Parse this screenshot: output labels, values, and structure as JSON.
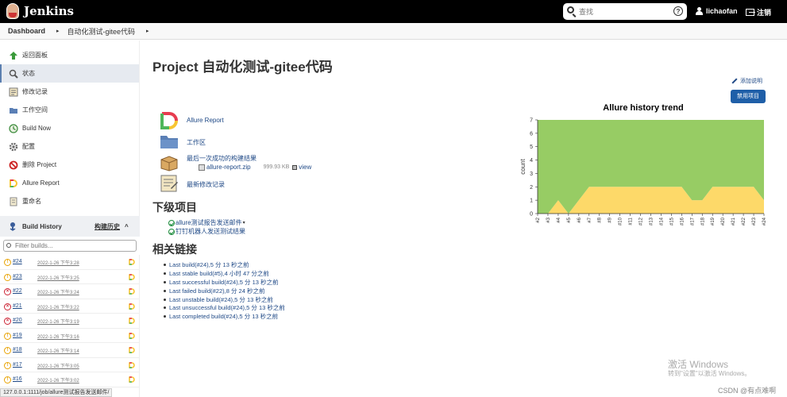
{
  "header": {
    "app_name": "Jenkins",
    "search_placeholder": "查找",
    "help_glyph": "?",
    "username": "lichaofan",
    "logout_label": "注销"
  },
  "breadcrumb": {
    "items": [
      "Dashboard",
      "自动化测试-gitee代码"
    ]
  },
  "sidebar": {
    "tasks": [
      {
        "label": "返回面板",
        "icon": "arrow-up-icon"
      },
      {
        "label": "状态",
        "icon": "magnifier-icon",
        "active": true
      },
      {
        "label": "修改记录",
        "icon": "notepad-icon"
      },
      {
        "label": "工作空间",
        "icon": "folder-icon"
      },
      {
        "label": "Build Now",
        "icon": "clock-icon"
      },
      {
        "label": "配置",
        "icon": "gear-icon"
      },
      {
        "label": "删除 Project",
        "icon": "no-entry-icon"
      },
      {
        "label": "Allure Report",
        "icon": "allure-icon"
      },
      {
        "label": "重命名",
        "icon": "rename-icon"
      }
    ]
  },
  "build_history": {
    "title": "Build History",
    "title_cn": "构建历史",
    "chevron": "^",
    "filter_placeholder": "Filter builds...",
    "builds": [
      {
        "num": "#24",
        "date": "2022-1-26 下午3:28",
        "status": "unstable"
      },
      {
        "num": "#23",
        "date": "2022-1-26 下午3:25",
        "status": "unstable"
      },
      {
        "num": "#22",
        "date": "2022-1-26 下午3:24",
        "status": "failed"
      },
      {
        "num": "#21",
        "date": "2022-1-26 下午3:22",
        "status": "failed"
      },
      {
        "num": "#20",
        "date": "2022-1-26 下午3:19",
        "status": "failed"
      },
      {
        "num": "#19",
        "date": "2022-1-26 下午3:16",
        "status": "unstable"
      },
      {
        "num": "#18",
        "date": "2022-1-26 下午3:14",
        "status": "unstable"
      },
      {
        "num": "#17",
        "date": "2022-1-26 下午3:05",
        "status": "unstable"
      },
      {
        "num": "#16",
        "date": "2022-1-26 下午3:02",
        "status": "unstable"
      }
    ]
  },
  "status_bar_url": "127.0.0.1:1111/job/allure测试报告发送邮件/",
  "main": {
    "title": "Project 自动化测试-gitee代码",
    "add_description": "添加说明",
    "disable_button": "禁用项目",
    "summary": {
      "allure_report": "Allure Report",
      "workspace": "工作区",
      "last_success_artifacts": "最后一次成功的构建结果",
      "artifact_name": "allure-report.zip",
      "artifact_size": "999.93 KB",
      "artifact_view": "view",
      "recent_changes": "最新修改记录"
    },
    "downstream_title": "下级项目",
    "downstream": [
      {
        "label": "allure测试报告发送邮件",
        "has_caret": true
      },
      {
        "label": "钉钉机器人发送测试结果",
        "has_caret": false
      }
    ],
    "downstream_caret": "▾",
    "permalinks_title": "相关链接",
    "permalinks": [
      "Last build(#24),5 分 13 秒之前",
      "Last stable build(#5),4 小时 47 分之前",
      "Last successful build(#24),5 分 13 秒之前",
      "Last failed build(#22),8 分 24 秒之前",
      "Last unstable build(#24),5 分 13 秒之前",
      "Last unsuccessful build(#24),5 分 13 秒之前",
      "Last completed build(#24),5 分 13 秒之前"
    ]
  },
  "chart_data": {
    "type": "area",
    "title": "Allure history trend",
    "ylabel": "count",
    "xlabel": "",
    "categories": [
      "#2",
      "#3",
      "#4",
      "#5",
      "#6",
      "#7",
      "#8",
      "#9",
      "#10",
      "#11",
      "#12",
      "#13",
      "#14",
      "#15",
      "#16",
      "#17",
      "#18",
      "#19",
      "#20",
      "#21",
      "#22",
      "#23",
      "#24"
    ],
    "series": [
      {
        "name": "",
        "color": "#fdd969",
        "values": [
          0,
          0,
          1,
          0,
          1,
          2,
          2,
          2,
          2,
          2,
          2,
          2,
          2,
          2,
          2,
          1,
          1,
          2,
          2,
          2,
          2,
          2,
          1
        ]
      },
      {
        "name": "",
        "color": "#97cc64",
        "values": [
          7,
          7,
          6,
          7,
          6,
          5,
          5,
          5,
          5,
          5,
          5,
          5,
          5,
          5,
          5,
          6,
          6,
          5,
          5,
          5,
          5,
          5,
          6
        ]
      }
    ],
    "ylim": [
      0,
      7
    ],
    "yticks": [
      0,
      1,
      2,
      3,
      4,
      5,
      6,
      7
    ],
    "grid": false
  },
  "watermark": {
    "line1": "激活 Windows",
    "line2": "转到\"设置\"以激活 Windows。"
  },
  "csdn": "CSDN @有点难啊"
}
